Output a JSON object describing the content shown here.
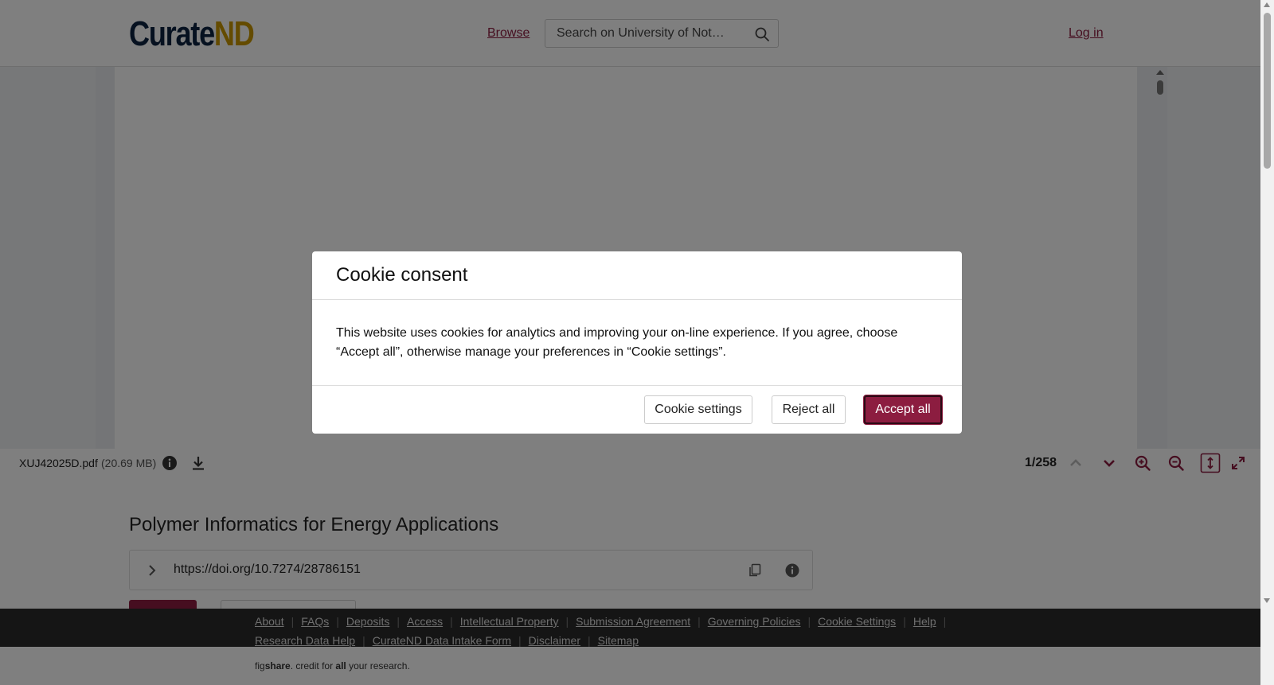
{
  "header": {
    "logo_part1": "Curate",
    "logo_part2": "ND",
    "browse_label": "Browse",
    "search_placeholder": "Search on University of Not…",
    "login_label": "Log in"
  },
  "viewer": {
    "file_name": "XUJ42025D.pdf",
    "file_size": "(20.69 MB)",
    "page_counter": "1/258",
    "icons": [
      "info-icon",
      "download-icon",
      "chevron-up-icon",
      "chevron-down-icon",
      "zoom-in-icon",
      "zoom-out-icon",
      "fit-height-icon",
      "fullscreen-icon"
    ]
  },
  "item": {
    "title": "Polymer Informatics for Energy Applications",
    "doi": "https://doi.org/10.7274/28786151"
  },
  "footer": {
    "links": [
      "About",
      "FAQs",
      "Deposits",
      "Access",
      "Intellectual Property",
      "Submission Agreement",
      "Governing Policies",
      "Cookie Settings",
      "Help",
      "Research Data Help",
      "CurateND Data Intake Form",
      "Disclaimer",
      "Sitemap"
    ],
    "figshare_pre": "fig",
    "figshare_brand": "share",
    "figshare_mid": ". credit for ",
    "figshare_all": "all",
    "figshare_post": " your research."
  },
  "modal": {
    "title": "Cookie consent",
    "body": "This website uses cookies for analytics and improving your on-line experience. If you agree, choose “Accept all”, otherwise manage your preferences in “Cookie settings”.",
    "settings_label": "Cookie settings",
    "reject_label": "Reject all",
    "accept_label": "Accept all"
  },
  "colors": {
    "brand_primary": "#8c1d40",
    "logo_navy": "#0c2340",
    "logo_gold": "#c99700",
    "footer_bg": "#2b2b2b"
  }
}
